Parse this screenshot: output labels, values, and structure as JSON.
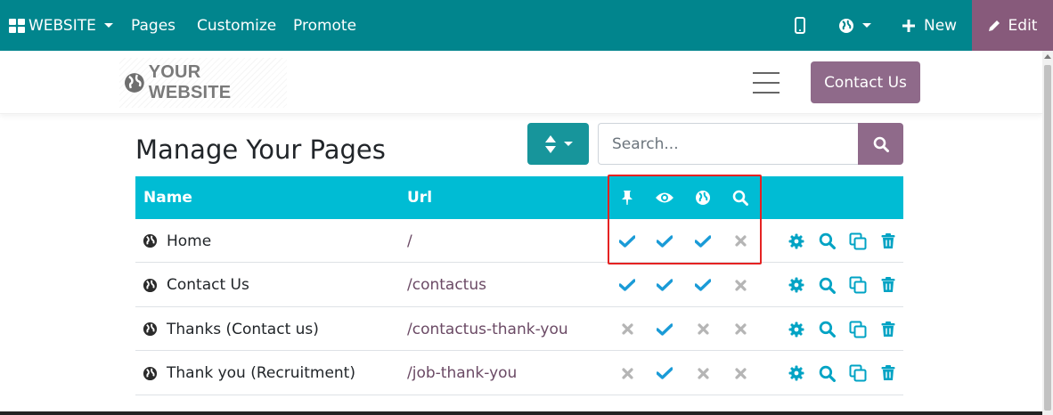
{
  "topbar": {
    "website_label": "WEBSITE",
    "pages_label": "Pages",
    "customize_label": "Customize",
    "promote_label": "Promote",
    "new_label": "New",
    "edit_label": "Edit"
  },
  "header": {
    "logo_text": "YOUR WEBSITE",
    "contact_button": "Contact Us"
  },
  "main": {
    "title": "Manage Your Pages",
    "search_placeholder": "Search...",
    "table": {
      "columns": {
        "name": "Name",
        "url": "Url"
      },
      "column_icons": [
        "pin-icon",
        "eye-icon",
        "globe-icon",
        "search-icon"
      ],
      "rows": [
        {
          "name": "Home",
          "url": "/",
          "flags": [
            true,
            true,
            true,
            false
          ]
        },
        {
          "name": "Contact Us",
          "url": "/contactus",
          "flags": [
            true,
            true,
            true,
            false
          ]
        },
        {
          "name": "Thanks (Contact us)",
          "url": "/contactus-thank-you",
          "flags": [
            false,
            true,
            false,
            false
          ]
        },
        {
          "name": "Thank you (Recruitment)",
          "url": "/job-thank-you",
          "flags": [
            false,
            true,
            false,
            false
          ]
        }
      ],
      "row_action_icons": [
        "gear-icon",
        "search-icon",
        "copy-icon",
        "trash-icon"
      ]
    }
  },
  "colors": {
    "topbar": "#01858d",
    "edit": "#875a7b",
    "accent": "#00bcd4",
    "check": "#1a9bd7",
    "cross": "#b5b5b5",
    "highlight": "#e52222"
  }
}
